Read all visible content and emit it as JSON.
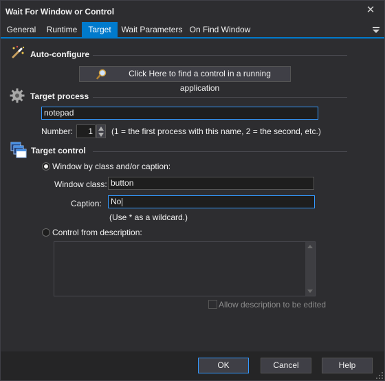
{
  "window": {
    "title": "Wait For Window or Control",
    "close_glyph": "✕"
  },
  "tabs": [
    {
      "label": "General",
      "active": false
    },
    {
      "label": "Runtime",
      "active": false
    },
    {
      "label": "Target",
      "active": true
    },
    {
      "label": "Wait Parameters",
      "active": false
    },
    {
      "label": "On Find Window",
      "active": false
    }
  ],
  "tab_menu_icon": "tab-dropdown-icon",
  "auto_configure": {
    "title": "Auto-configure",
    "icon": "magic-wand-icon",
    "find_button_label": "Click Here to find a control in a running application",
    "find_button_icon": "magnifier-icon"
  },
  "target_process": {
    "title": "Target process",
    "icon": "gear-icon",
    "process_name": "notepad",
    "number_label": "Number:",
    "number_value": "1",
    "number_hint": "(1 = the first process with this name, 2 = the second, etc.)"
  },
  "target_control": {
    "title": "Target control",
    "icon": "windows-icon",
    "radio_class_caption_label": "Window by class and/or caption:",
    "radio_class_caption_selected": true,
    "window_class_label": "Window class:",
    "window_class_value": "button",
    "caption_label": "Caption:",
    "caption_value": "No",
    "wildcard_hint": "(Use * as a wildcard.)",
    "radio_description_label": "Control from description:",
    "radio_description_selected": false,
    "description_value": "",
    "allow_edit_label": "Allow description to be edited",
    "allow_edit_checked": false
  },
  "footer": {
    "ok_label": "OK",
    "cancel_label": "Cancel",
    "help_label": "Help"
  },
  "colors": {
    "background": "#2d2d30",
    "accent": "#007acc",
    "focus_border": "#3399ff"
  }
}
